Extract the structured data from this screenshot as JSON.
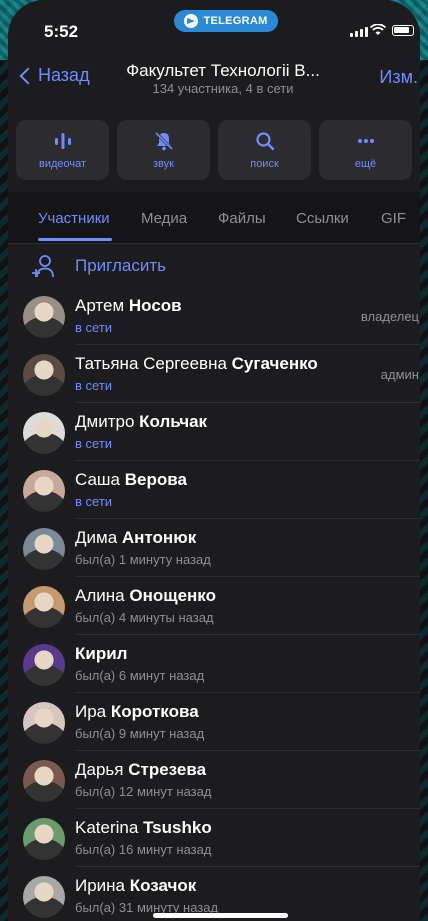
{
  "status_bar": {
    "time": "5:52",
    "pill_label": "TELEGRAM"
  },
  "nav": {
    "back_label": "Назад",
    "title": "Факультет Технологіі В...",
    "subtitle": "134 участника, 4 в сети",
    "edit_label": "Изм."
  },
  "actions": [
    {
      "label": "видеочат",
      "icon": "videochat-icon"
    },
    {
      "label": "звук",
      "icon": "bell-muted-icon"
    },
    {
      "label": "поиск",
      "icon": "search-icon"
    },
    {
      "label": "ещё",
      "icon": "more-icon"
    }
  ],
  "tabs": [
    "Участники",
    "Медиа",
    "Файлы",
    "Ссылки",
    "GIF"
  ],
  "invite": {
    "label": "Пригласить"
  },
  "members": [
    {
      "first": "Артем",
      "last": "Носов",
      "status": "в сети",
      "online": true,
      "role": "владелец",
      "avatar_color": "#9a8f86"
    },
    {
      "first": "Татьяна Сергеевна",
      "last": "Сугаченко",
      "status": "в сети",
      "online": true,
      "role": "админ",
      "avatar_color": "#5a4b43"
    },
    {
      "first": "Дмитро",
      "last": "Кольчак",
      "status": "в сети",
      "online": true,
      "role": "",
      "avatar_color": "#dcdcdc"
    },
    {
      "first": "Саша",
      "last": "Верова",
      "status": "в сети",
      "online": true,
      "role": "",
      "avatar_color": "#c8a898"
    },
    {
      "first": "Дима",
      "last": "Антонюк",
      "status": "был(а) 1 минуту назад",
      "online": false,
      "role": "",
      "avatar_color": "#7b8a98"
    },
    {
      "first": "Алина",
      "last": "Онощенко",
      "status": "был(а) 4 минуты назад",
      "online": false,
      "role": "",
      "avatar_color": "#c69a6e"
    },
    {
      "first": "",
      "last": "Кирил",
      "status": "был(а) 6 минут назад",
      "online": false,
      "role": "",
      "avatar_color": "#5a3a8f"
    },
    {
      "first": "Ира",
      "last": "Короткова",
      "status": "был(а) 9 минут назад",
      "online": false,
      "role": "",
      "avatar_color": "#d8c6c0"
    },
    {
      "first": "Дарья",
      "last": "Стрезева",
      "status": "был(а) 12 минут назад",
      "online": false,
      "role": "",
      "avatar_color": "#7a5a50"
    },
    {
      "first": "Katerina",
      "last": "Tsushko",
      "status": "был(а) 16 минут назад",
      "online": false,
      "role": "",
      "avatar_color": "#6a9a6e"
    },
    {
      "first": "Ирина",
      "last": "Козачок",
      "status": "был(а) 31 минуту назад",
      "online": false,
      "role": "",
      "avatar_color": "#a8a8a8"
    }
  ],
  "colors": {
    "accent": "#6f8bff",
    "background": "#1c1c1e",
    "button_bg": "#2c2c2e",
    "secondary_text": "#8e8e93"
  }
}
